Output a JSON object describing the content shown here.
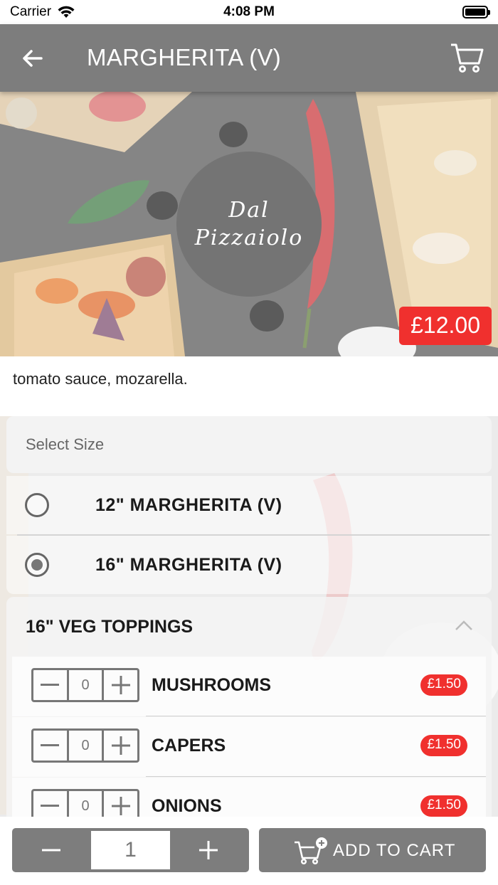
{
  "status_bar": {
    "carrier": "Carrier",
    "time": "4:08 PM"
  },
  "header": {
    "title": "MARGHERITA (V)",
    "back_icon": "arrow-left-icon",
    "cart_icon": "cart-icon",
    "background": "#7d7d7d"
  },
  "hero": {
    "logo_line1": "Dal",
    "logo_line2": "Pizzaiolo",
    "price": "£12.00",
    "price_color": "#f0302e"
  },
  "description": "tomato sauce, mozarella.",
  "size_section": {
    "placeholder": "Select Size",
    "options": [
      {
        "label": "12\" MARGHERITA (V)",
        "selected": false
      },
      {
        "label": "16\" MARGHERITA (V)",
        "selected": true
      }
    ]
  },
  "toppings_section": {
    "title": "16\" VEG TOPPINGS",
    "items": [
      {
        "name": "MUSHROOMS",
        "quantity": "0",
        "price": "£1.50"
      },
      {
        "name": "CAPERS",
        "quantity": "0",
        "price": "£1.50"
      },
      {
        "name": "ONIONS",
        "quantity": "0",
        "price": "£1.50"
      }
    ]
  },
  "bottom_bar": {
    "quantity": "1",
    "add_to_cart_label": "ADD TO CART"
  }
}
